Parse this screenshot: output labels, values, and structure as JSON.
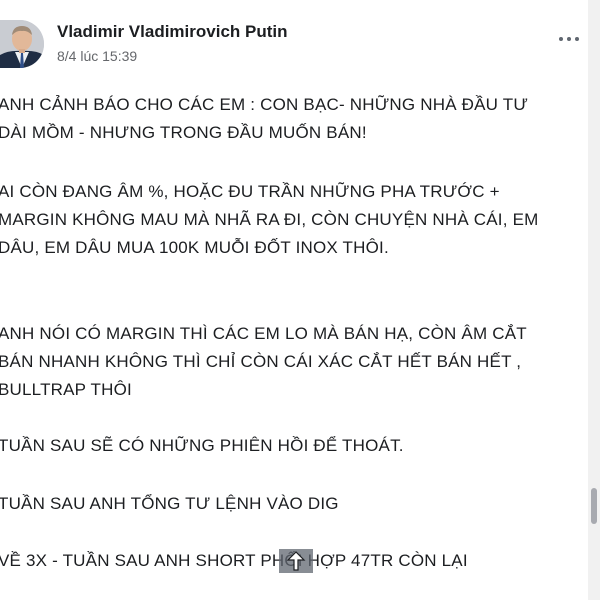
{
  "post": {
    "author": "Vladimir Vladimirovich Putin",
    "timestamp": "8/4 lúc 15:39",
    "avatar_icon": "profile-photo",
    "more_icon": "more-options-icon",
    "paragraphs": [
      {
        "lines": [
          "ANH CẢNH BÁO CHO CÁC EM : CON BẠC- NHỮNG NHÀ ĐẦU TƯ",
          "DÀI MỒM - NHƯNG TRONG ĐẦU MUỐN BÁN!"
        ]
      },
      {
        "lines": [
          "AI CÒN ĐANG ÂM %, HOẶC ĐU TRẦN NHỮNG PHA TRƯỚC +",
          "MARGIN KHÔNG MAU MÀ NHÃ RA ĐI, CÒN CHUYỆN NHÀ CÁI, EM",
          "DÂU, EM DÂU MUA 100K MUỖI ĐỐT INOX THÔI."
        ]
      },
      {
        "lines": [
          "ANH NÓI CÓ MARGIN THÌ CÁC EM LO MÀ BÁN HẠ, CÒN ÂM CẮT",
          "BÁN NHANH KHÔNG THÌ CHỈ CÒN CÁI XÁC CẮT HẾT BÁN HẾT ,",
          "BULLTRAP THÔI"
        ]
      },
      {
        "lines": [
          "TUẦN SAU SẼ CÓ NHỮNG PHIÊN HỒI ĐỂ THOÁT."
        ]
      },
      {
        "lines": [
          "TUẦN SAU ANH TỔNG TƯ LỆNH VÀO DIG"
        ]
      },
      {
        "lines": [
          "VỀ 3X - TUẦN SAU ANH SHORT PHỐI HỢP 47TR CÒN LẠI"
        ]
      }
    ]
  },
  "overlay": {
    "scroll_top_icon": "arrow-up-icon"
  },
  "colors": {
    "text": "#1c1e21",
    "secondary_text": "#65676b",
    "background": "#ffffff"
  }
}
